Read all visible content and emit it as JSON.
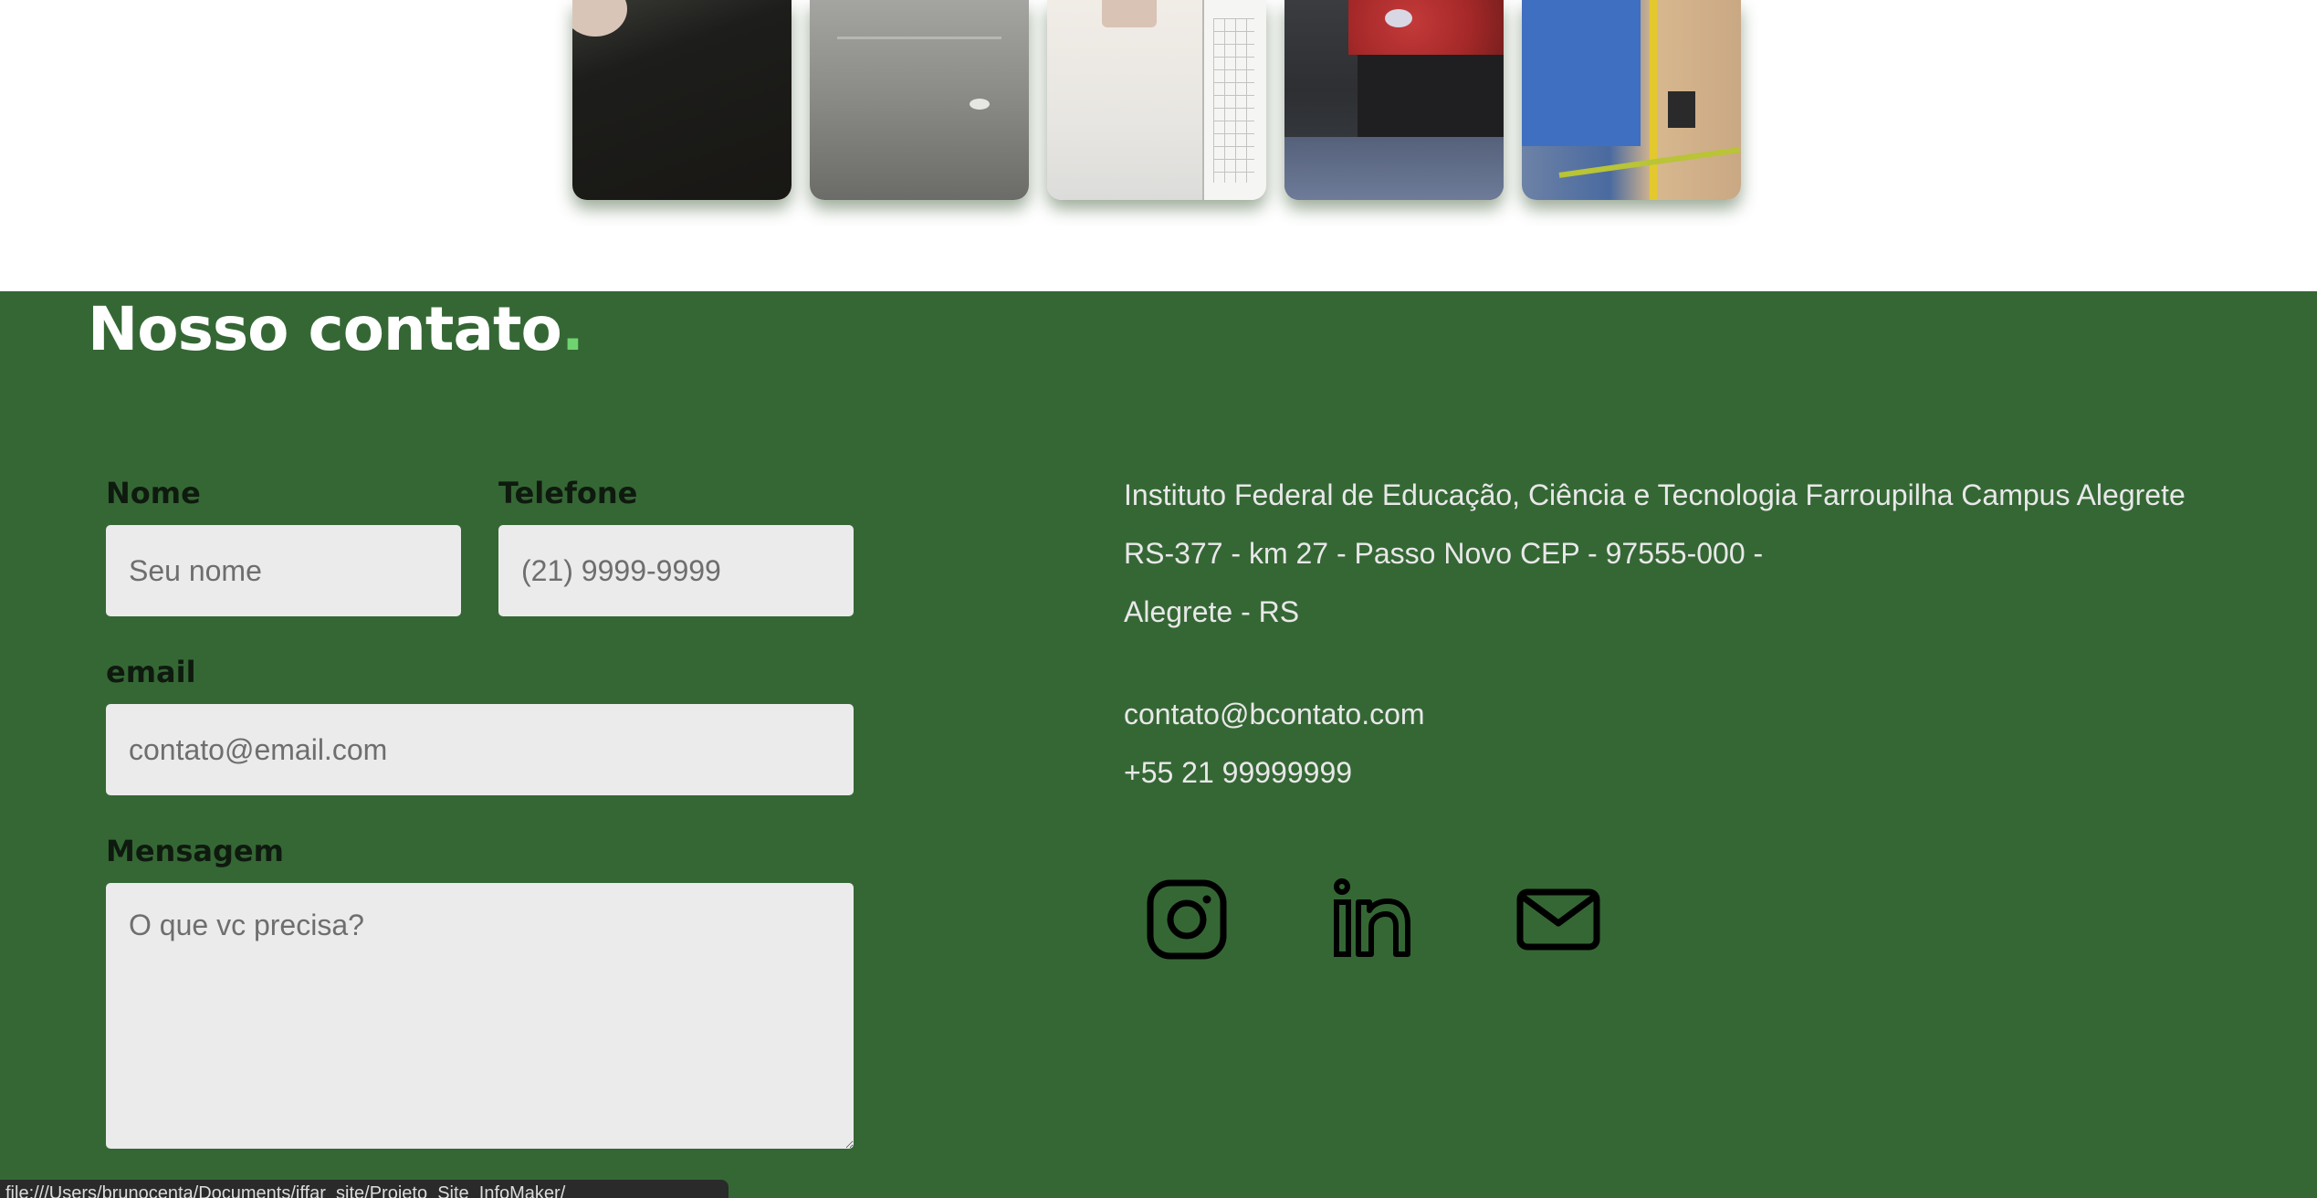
{
  "gallery": {
    "photos": [
      {
        "name": "photo-1"
      },
      {
        "name": "photo-2"
      },
      {
        "name": "photo-3"
      },
      {
        "name": "photo-4"
      },
      {
        "name": "photo-5"
      }
    ]
  },
  "contact": {
    "title": "Nosso contato",
    "title_accent": ".",
    "form": {
      "nome_label": "Nome",
      "nome_placeholder": "Seu nome",
      "telefone_label": "Telefone",
      "telefone_placeholder": "(21) 9999-9999",
      "email_label": "email",
      "email_placeholder": "contato@email.com",
      "mensagem_label": "Mensagem",
      "mensagem_placeholder": "O que vc precisa?"
    },
    "info": {
      "institution": "Instituto Federal de Educação, Ciência e Tecnologia Farroupilha Campus Alegrete",
      "address_line": "RS-377 - km 27 - Passo Novo CEP - 97555-000 -",
      "city": "Alegrete - RS",
      "email": "contato@bcontato.com",
      "phone": "+55 21 99999999"
    },
    "social": [
      "instagram-icon",
      "linkedin-icon",
      "mail-icon"
    ],
    "colors": {
      "background": "#356735",
      "accent": "#6fd46f",
      "title": "#ffffff",
      "label": "#0f1a0f",
      "info_text": "#e8e8e8",
      "field_bg": "#ebebeb"
    }
  },
  "status_bar": {
    "url": "file:///Users/brunocenta/Documents/iffar_site/Projeto_Site_InfoMaker/"
  }
}
